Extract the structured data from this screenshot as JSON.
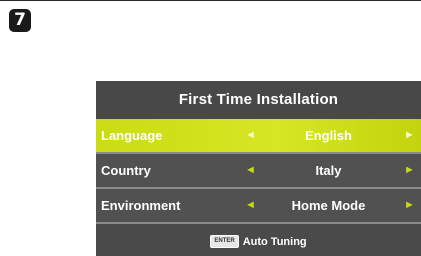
{
  "step": {
    "number": "7"
  },
  "dialog": {
    "title": "First Time Installation",
    "rows": [
      {
        "label": "Language",
        "left_arrow": "◄",
        "value": "English",
        "right_arrow": "►",
        "selected": true
      },
      {
        "label": "Country",
        "left_arrow": "◄",
        "value": "Italy",
        "right_arrow": "►",
        "selected": false
      },
      {
        "label": "Environment",
        "left_arrow": "◄",
        "value": "Home Mode",
        "right_arrow": "►",
        "selected": false
      }
    ],
    "footer": {
      "key_label": "ENTER",
      "action_label": "Auto Tuning"
    }
  },
  "colors": {
    "highlight": "#d6e623",
    "panel_background": "#4b4b4b",
    "arrow_accent": "#c6dc14"
  }
}
